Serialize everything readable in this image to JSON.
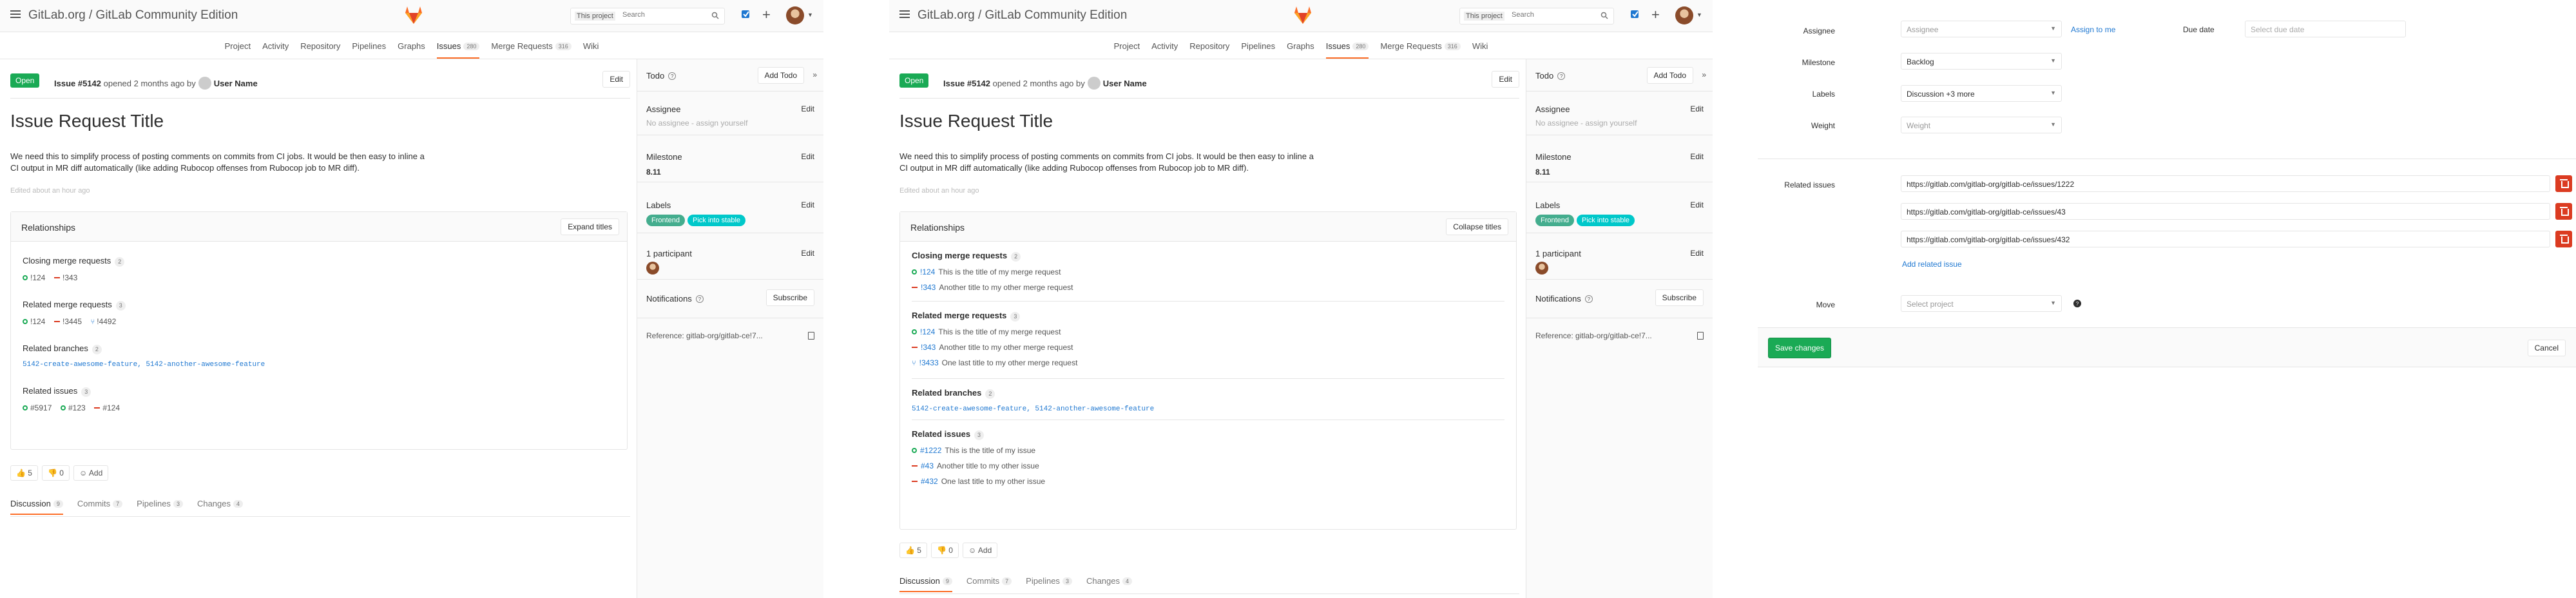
{
  "nav": {
    "breadcrumb": "GitLab.org / GitLab Community Edition",
    "search_scope": "This project",
    "search_placeholder": "Search"
  },
  "tabs": [
    {
      "label": "Project"
    },
    {
      "label": "Activity"
    },
    {
      "label": "Repository"
    },
    {
      "label": "Pipelines"
    },
    {
      "label": "Graphs"
    },
    {
      "label": "Issues",
      "count": "280"
    },
    {
      "label": "Merge Requests",
      "count": "316"
    },
    {
      "label": "Wiki"
    }
  ],
  "issue": {
    "status": "Open",
    "number": "Issue #5142",
    "opened": "opened 2 months ago by",
    "author": "User Name",
    "edit_label": "Edit",
    "title": "Issue Request Title",
    "description_line1": "We need this to simplify process of posting comments on commits from CI jobs. It would be then easy to inline a",
    "description_line2": "CI output in MR diff automatically (like adding Rubocop offenses from Rubocop job to MR diff).",
    "edited": "Edited about an hour ago"
  },
  "relationships": {
    "title": "Relationships",
    "expand_label": "Expand titles",
    "collapse_label": "Collapse titles",
    "closing_mr": {
      "title": "Closing merge requests",
      "count": "2",
      "items": [
        {
          "ref": "!124",
          "text": "This is the title of my merge request"
        },
        {
          "ref": "!343",
          "text": "Another title to my other merge request"
        }
      ]
    },
    "related_mr": {
      "title": "Related merge requests",
      "count": "3",
      "items": [
        {
          "ref": "!124",
          "text": "This is the title of my merge request"
        },
        {
          "ref": "!3445",
          "short": "!3445",
          "full": "!343",
          "text": "Another title to my other merge request"
        },
        {
          "ref": "!4492",
          "full": "!3433",
          "text": "One last title to my other merge request"
        }
      ]
    },
    "branches": {
      "title": "Related branches",
      "count": "2",
      "value": "5142-create-awesome-feature, 5142-another-awesome-feature"
    },
    "issues": {
      "title": "Related issues",
      "count": "3",
      "items": [
        {
          "ref": "#5917",
          "full": "#1222",
          "text": "This is the title of my issue"
        },
        {
          "ref": "#123",
          "full": "#43",
          "text": "Another title to my other issue"
        },
        {
          "ref": "#124",
          "full": "#432",
          "text": "One last title to my other issue"
        }
      ]
    }
  },
  "awards": {
    "thumbs_up": "5",
    "thumbs_down": "0",
    "add_label": "Add"
  },
  "bottom_tabs": [
    {
      "label": "Discussion",
      "count": "9"
    },
    {
      "label": "Commits",
      "count": "7"
    },
    {
      "label": "Pipelines",
      "count": "3"
    },
    {
      "label": "Changes",
      "count": "4"
    }
  ],
  "sidebar": {
    "todo": "Todo",
    "add_todo": "Add Todo",
    "assignee_label": "Assignee",
    "assignee_value": "No assignee - assign yourself",
    "milestone_label": "Milestone",
    "milestone_value": "8.11",
    "labels_label": "Labels",
    "labels": [
      {
        "text": "Frontend",
        "color": "#44ad8e"
      },
      {
        "text": "Pick into stable",
        "color": "#00c8ca"
      }
    ],
    "participants_label": "1 participant",
    "notifications_label": "Notifications",
    "subscribe_label": "Subscribe",
    "reference": "Reference: gitlab-org/gitlab-ce!7...",
    "edit": "Edit"
  },
  "form": {
    "assignee_label": "Assignee",
    "assignee_placeholder": "Assignee",
    "assign_to_me": "Assign to me",
    "due_date_label": "Due date",
    "due_date_placeholder": "Select due date",
    "milestone_label": "Milestone",
    "milestone_value": "Backlog",
    "labels_label": "Labels",
    "labels_value": "Discussion +3 more",
    "weight_label": "Weight",
    "weight_placeholder": "Weight",
    "related_label": "Related issues",
    "related_urls": [
      "https://gitlab.com/gitlab-org/gitlab-ce/issues/1222",
      "https://gitlab.com/gitlab-org/gitlab-ce/issues/43",
      "https://gitlab.com/gitlab-org/gitlab-ce/issues/432"
    ],
    "add_related": "Add related issue",
    "move_label": "Move",
    "move_placeholder": "Select project",
    "save": "Save changes",
    "cancel": "Cancel"
  },
  "colors": {
    "accent": "#fc6d26",
    "green": "#1aaa55",
    "red": "#db3b21",
    "link": "#1f78d1"
  }
}
